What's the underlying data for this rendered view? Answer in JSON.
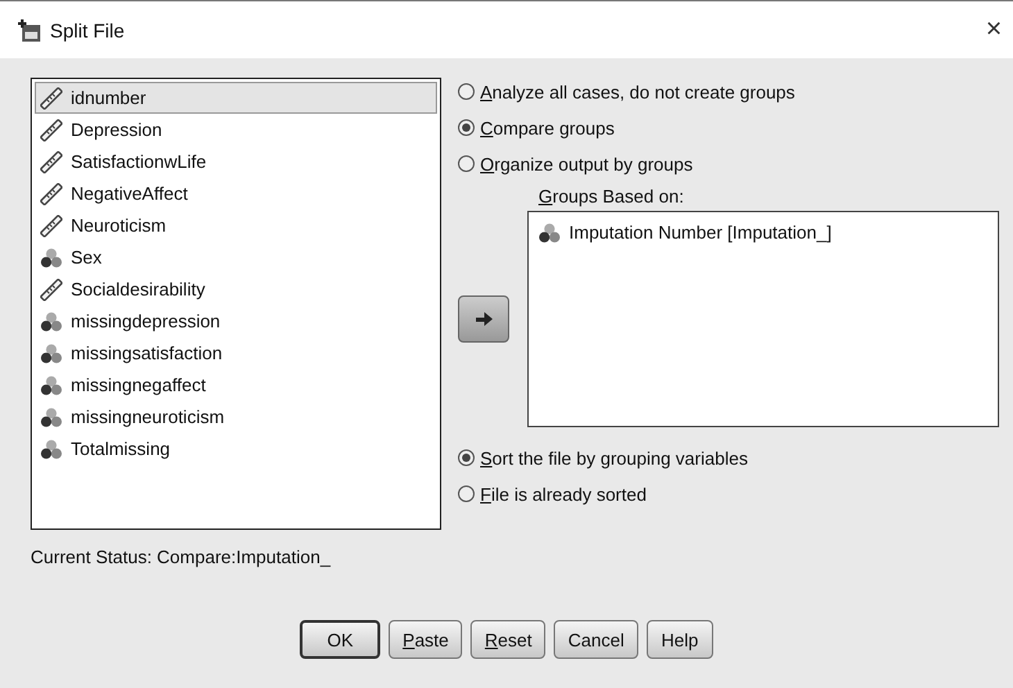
{
  "window": {
    "title": "Split File",
    "close": "×"
  },
  "variables": [
    {
      "name": "idnumber",
      "kind": "scale",
      "selected": true
    },
    {
      "name": "Depression",
      "kind": "scale",
      "selected": false
    },
    {
      "name": "SatisfactionwLife",
      "kind": "scale",
      "selected": false
    },
    {
      "name": "NegativeAffect",
      "kind": "scale",
      "selected": false
    },
    {
      "name": "Neuroticism",
      "kind": "scale",
      "selected": false
    },
    {
      "name": "Sex",
      "kind": "nominal",
      "selected": false
    },
    {
      "name": "Socialdesirability",
      "kind": "scale",
      "selected": false
    },
    {
      "name": "missingdepression",
      "kind": "nominal",
      "selected": false
    },
    {
      "name": "missingsatisfaction",
      "kind": "nominal",
      "selected": false
    },
    {
      "name": "missingnegaffect",
      "kind": "nominal",
      "selected": false
    },
    {
      "name": "missingneuroticism",
      "kind": "nominal",
      "selected": false
    },
    {
      "name": "Totalmissing",
      "kind": "nominal",
      "selected": false
    }
  ],
  "mode_options": [
    {
      "label": "Analyze all cases, do not create groups",
      "selected": false,
      "mnemonic": true
    },
    {
      "label": "Compare groups",
      "selected": true,
      "mnemonic": true
    },
    {
      "label": "Organize output by groups",
      "selected": false,
      "mnemonic": true
    }
  ],
  "groups_label": "Groups Based on:",
  "groups": [
    {
      "name": "Imputation Number [Imputation_]",
      "kind": "nominal"
    }
  ],
  "sort_options": [
    {
      "label": "Sort the file by grouping variables",
      "selected": true,
      "mnemonic": true
    },
    {
      "label": "File is already sorted",
      "selected": false,
      "mnemonic": true
    }
  ],
  "status": "Current Status: Compare:Imputation_",
  "buttons": [
    {
      "label": "OK",
      "mnemonic": false,
      "default": true
    },
    {
      "label": "Paste",
      "mnemonic": true,
      "default": false
    },
    {
      "label": "Reset",
      "mnemonic": true,
      "default": false
    },
    {
      "label": "Cancel",
      "mnemonic": false,
      "default": false
    },
    {
      "label": "Help",
      "mnemonic": false,
      "default": false
    }
  ]
}
